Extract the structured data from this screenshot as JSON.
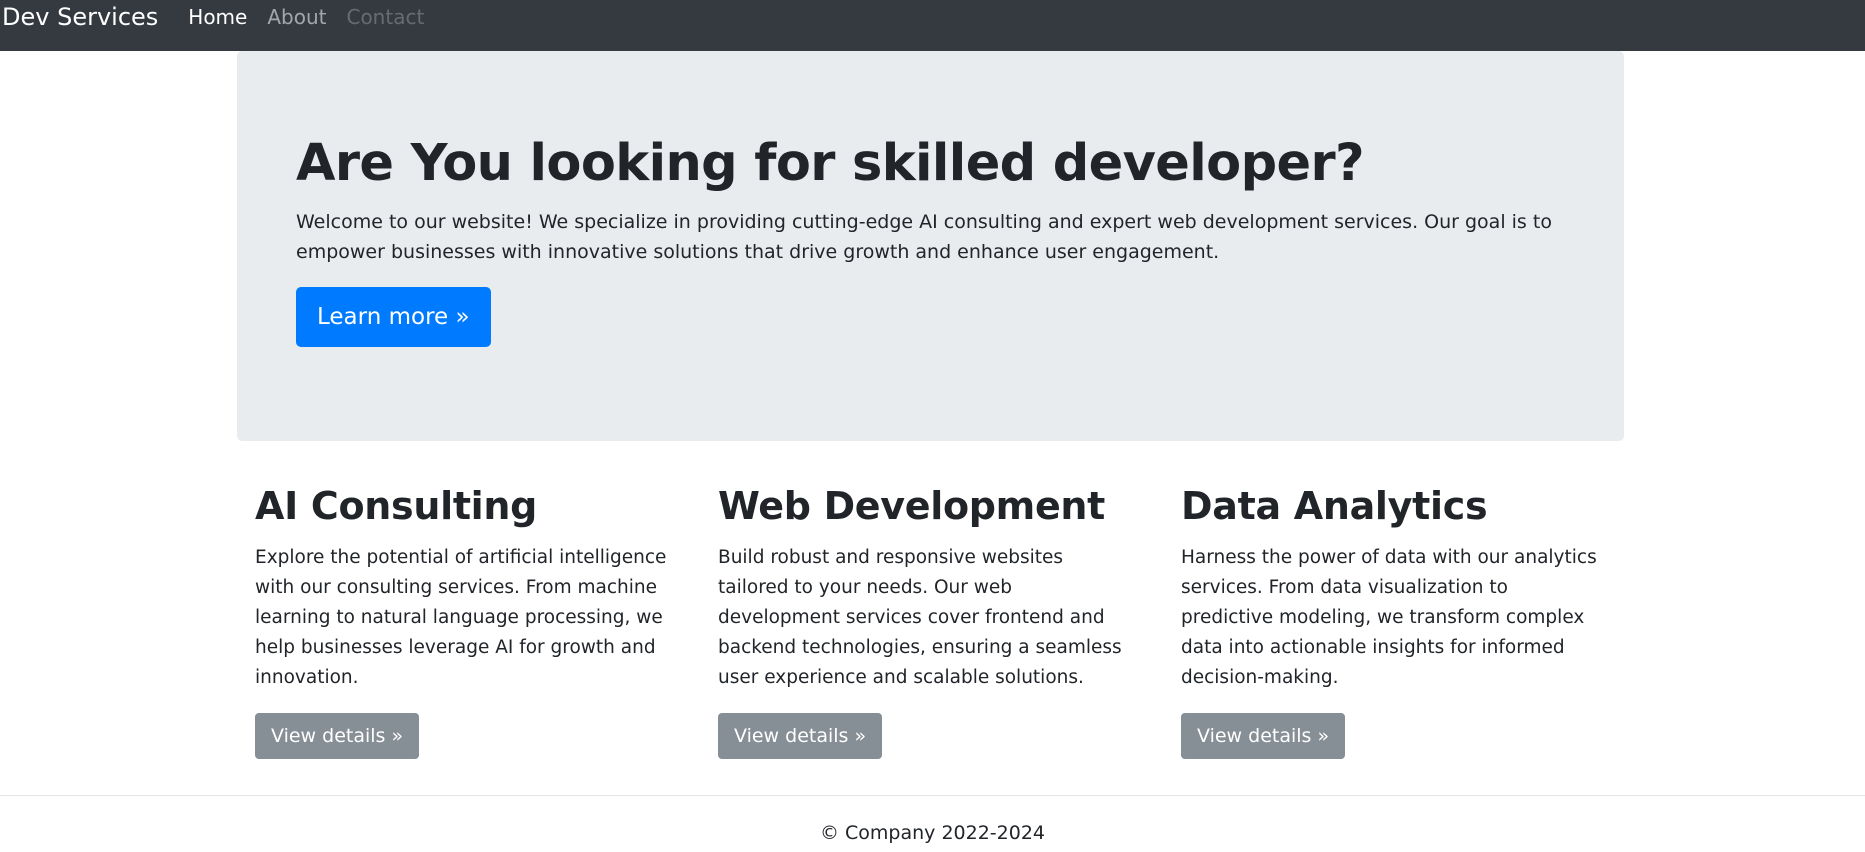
{
  "navbar": {
    "brand": "Dev Services",
    "links": [
      {
        "label": "Home",
        "state": "active"
      },
      {
        "label": "About",
        "state": "normal"
      },
      {
        "label": "Contact",
        "state": "disabled"
      }
    ]
  },
  "hero": {
    "title": "Are You looking for skilled developer?",
    "text": "Welcome to our website! We specialize in providing cutting-edge AI consulting and expert web development services. Our goal is to empower businesses with innovative solutions that drive growth and enhance user engagement.",
    "button_label": "Learn more »"
  },
  "services": [
    {
      "title": "AI Consulting",
      "text": "Explore the potential of artificial intelligence with our consulting services. From machine learning to natural language processing, we help businesses leverage AI for growth and innovation.",
      "button_label": "View details »"
    },
    {
      "title": "Web Development",
      "text": "Build robust and responsive websites tailored to your needs. Our web development services cover frontend and backend technologies, ensuring a seamless user experience and scalable solutions.",
      "button_label": "View details »"
    },
    {
      "title": "Data Analytics",
      "text": "Harness the power of data with our analytics services. From data visualization to predictive modeling, we transform complex data into actionable insights for informed decision-making.",
      "button_label": "View details »"
    }
  ],
  "footer": {
    "text": "© Company 2022-2024"
  },
  "colors": {
    "navbar_bg": "#343a40",
    "hero_bg": "#e9ecef",
    "primary": "#007bff",
    "secondary": "#868e96",
    "text": "#212529"
  }
}
